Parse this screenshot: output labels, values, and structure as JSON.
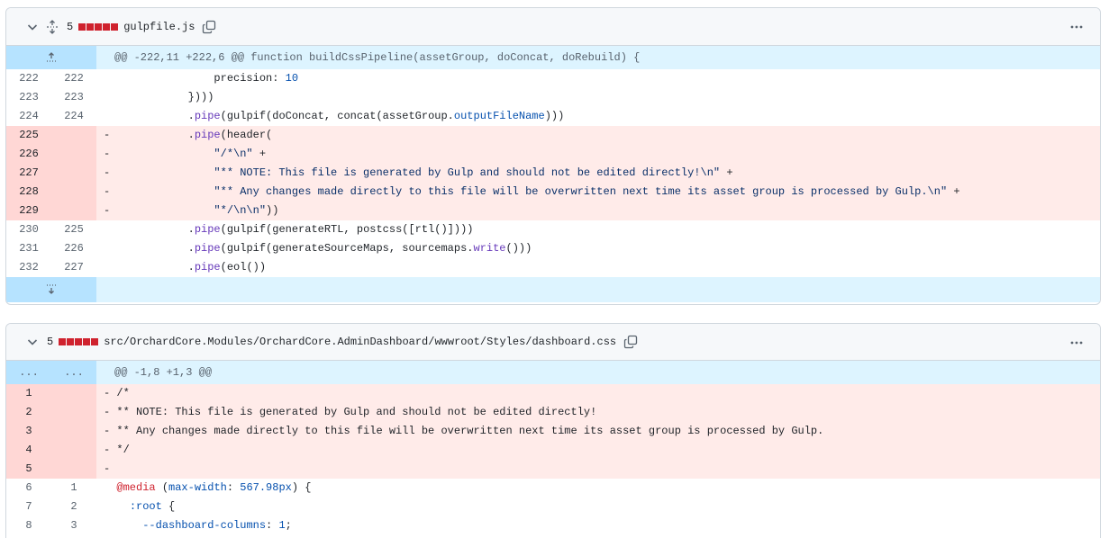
{
  "files": [
    {
      "change_count": "5",
      "name": "gulpfile.js",
      "hunk_header": "@@ -222,11 +222,6 @@ function buildCssPipeline(assetGroup, doConcat, doRebuild) {",
      "lines": [
        {
          "type": "ctx",
          "old": "222",
          "new": "222",
          "sign": " ",
          "segments": [
            {
              "t": "                precision: "
            },
            {
              "t": "10",
              "c": "num"
            }
          ]
        },
        {
          "type": "ctx",
          "old": "223",
          "new": "223",
          "sign": " ",
          "segments": [
            {
              "t": "            })))"
            }
          ]
        },
        {
          "type": "ctx",
          "old": "224",
          "new": "224",
          "sign": " ",
          "segments": [
            {
              "t": "            ."
            },
            {
              "t": "pipe",
              "c": "kw"
            },
            {
              "t": "(gulpif(doConcat, concat(assetGroup."
            },
            {
              "t": "outputFileName",
              "c": "num"
            },
            {
              "t": ")))"
            }
          ]
        },
        {
          "type": "del",
          "old": "225",
          "new": "",
          "sign": "-",
          "segments": [
            {
              "t": "            ."
            },
            {
              "t": "pipe",
              "c": "kw"
            },
            {
              "t": "(header("
            }
          ]
        },
        {
          "type": "del",
          "old": "226",
          "new": "",
          "sign": "-",
          "segments": [
            {
              "t": "                "
            },
            {
              "t": "\"/*\\n\"",
              "c": "str"
            },
            {
              "t": " +"
            }
          ]
        },
        {
          "type": "del",
          "old": "227",
          "new": "",
          "sign": "-",
          "segments": [
            {
              "t": "                "
            },
            {
              "t": "\"** NOTE: This file is generated by Gulp and should not be edited directly!\\n\"",
              "c": "str"
            },
            {
              "t": " +"
            }
          ]
        },
        {
          "type": "del",
          "old": "228",
          "new": "",
          "sign": "-",
          "segments": [
            {
              "t": "                "
            },
            {
              "t": "\"** Any changes made directly to this file will be overwritten next time its asset group is processed by Gulp.\\n\"",
              "c": "str"
            },
            {
              "t": " +"
            }
          ]
        },
        {
          "type": "del",
          "old": "229",
          "new": "",
          "sign": "-",
          "segments": [
            {
              "t": "                "
            },
            {
              "t": "\"*/\\n\\n\"",
              "c": "str"
            },
            {
              "t": "))"
            }
          ]
        },
        {
          "type": "ctx",
          "old": "230",
          "new": "225",
          "sign": " ",
          "segments": [
            {
              "t": "            ."
            },
            {
              "t": "pipe",
              "c": "kw"
            },
            {
              "t": "(gulpif(generateRTL, postcss([rtl()])))"
            }
          ]
        },
        {
          "type": "ctx",
          "old": "231",
          "new": "226",
          "sign": " ",
          "segments": [
            {
              "t": "            ."
            },
            {
              "t": "pipe",
              "c": "kw"
            },
            {
              "t": "(gulpif(generateSourceMaps, sourcemaps."
            },
            {
              "t": "write",
              "c": "kw"
            },
            {
              "t": "()))"
            }
          ]
        },
        {
          "type": "ctx",
          "old": "232",
          "new": "227",
          "sign": " ",
          "segments": [
            {
              "t": "            ."
            },
            {
              "t": "pipe",
              "c": "kw"
            },
            {
              "t": "(eol())"
            }
          ]
        }
      ]
    },
    {
      "change_count": "5",
      "name": "src/OrchardCore.Modules/OrchardCore.AdminDashboard/wwwroot/Styles/dashboard.css",
      "hunk_header": "@@ -1,8 +1,3 @@",
      "hunk_gutter_old": "...",
      "hunk_gutter_new": "...",
      "lines": [
        {
          "type": "del",
          "old": "1",
          "new": "",
          "sign": "-",
          "segments": [
            {
              "t": " /*"
            }
          ]
        },
        {
          "type": "del",
          "old": "2",
          "new": "",
          "sign": "-",
          "segments": [
            {
              "t": " ** NOTE: This file is generated by Gulp and should not be edited directly!"
            }
          ]
        },
        {
          "type": "del",
          "old": "3",
          "new": "",
          "sign": "-",
          "segments": [
            {
              "t": " ** Any changes made directly to this file will be overwritten next time its asset group is processed by Gulp."
            }
          ]
        },
        {
          "type": "del",
          "old": "4",
          "new": "",
          "sign": "-",
          "segments": [
            {
              "t": " */"
            }
          ]
        },
        {
          "type": "del",
          "old": "5",
          "new": "",
          "sign": "-",
          "segments": [
            {
              "t": ""
            }
          ]
        },
        {
          "type": "ctx",
          "old": "6",
          "new": "1",
          "sign": " ",
          "segments": [
            {
              "t": " "
            },
            {
              "t": "@media",
              "c": "at"
            },
            {
              "t": " ("
            },
            {
              "t": "max-width",
              "c": "prop"
            },
            {
              "t": ": "
            },
            {
              "t": "567.98px",
              "c": "num"
            },
            {
              "t": ") {"
            }
          ]
        },
        {
          "type": "ctx",
          "old": "7",
          "new": "2",
          "sign": " ",
          "segments": [
            {
              "t": "   "
            },
            {
              "t": ":root",
              "c": "prop"
            },
            {
              "t": " {"
            }
          ]
        },
        {
          "type": "ctx",
          "old": "8",
          "new": "3",
          "sign": " ",
          "segments": [
            {
              "t": "     "
            },
            {
              "t": "--dashboard-columns",
              "c": "prop"
            },
            {
              "t": ": "
            },
            {
              "t": "1",
              "c": "num"
            },
            {
              "t": ";"
            }
          ]
        }
      ]
    }
  ],
  "icons": {
    "chevron": "chevron-down-icon",
    "expand": "unfold-icon",
    "copy": "copy-icon",
    "kebab": "kebab-horizontal-icon",
    "expand_up": "fold-up-icon",
    "expand_down": "fold-down-icon"
  },
  "colors": {
    "deletion_gutter": "#ffd7d5",
    "deletion_line": "#ffebe9",
    "hunk_gutter": "#b6e3ff",
    "hunk_line": "#ddf4ff",
    "diffstat_red": "#cf222e"
  }
}
